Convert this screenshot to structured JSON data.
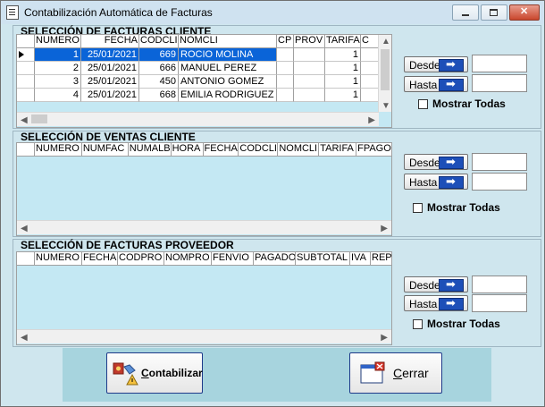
{
  "window": {
    "title": "Contabilización Automática de Facturas"
  },
  "facturas_cliente": {
    "title": "SELECCIÓN DE FACTURAS CLIENTE",
    "columns": [
      "",
      "NUMERO",
      "FECHA",
      "CODCLI",
      "NOMCLI",
      "CP",
      "PROV",
      "TARIFA",
      "C"
    ],
    "rows": [
      [
        "",
        "1",
        "25/01/2021",
        "669",
        "ROCIO MOLINA",
        "",
        "",
        "1",
        ""
      ],
      [
        "",
        "2",
        "25/01/2021",
        "666",
        "MANUEL PEREZ",
        "",
        "",
        "1",
        ""
      ],
      [
        "",
        "3",
        "25/01/2021",
        "450",
        "ANTONIO GOMEZ",
        "",
        "",
        "1",
        ""
      ],
      [
        "",
        "4",
        "25/01/2021",
        "668",
        "EMILIA RODRIGUEZ",
        "",
        "",
        "1",
        ""
      ]
    ],
    "desde_label": "Desde",
    "hasta_label": "Hasta",
    "mostrar_label": "Mostrar Todas"
  },
  "ventas_cliente": {
    "title": "SELECCIÓN DE VENTAS CLIENTE",
    "columns": [
      "",
      "NUMERO",
      "NUMFAC",
      "NUMALB",
      "HORA",
      "FECHA",
      "CODCLI",
      "NOMCLI",
      "TARIFA",
      "FPAGO"
    ],
    "desde_label": "Desde",
    "hasta_label": "Hasta",
    "mostrar_label": "Mostrar Todas"
  },
  "facturas_proveedor": {
    "title": "SELECCIÓN DE FACTURAS PROVEEDOR",
    "columns": [
      "",
      "NUMERO",
      "FECHA",
      "CODPRO",
      "NOMPRO",
      "FENVIO",
      "PAGADO",
      "SUBTOTAL",
      "IVA",
      "REP"
    ],
    "desde_label": "Desde",
    "hasta_label": "Hasta",
    "mostrar_label": "Mostrar Todas"
  },
  "actions": {
    "contabilizar_first": "C",
    "contabilizar_rest": "ontabilizar",
    "cerrar_first": "C",
    "cerrar_rest": "errar"
  }
}
